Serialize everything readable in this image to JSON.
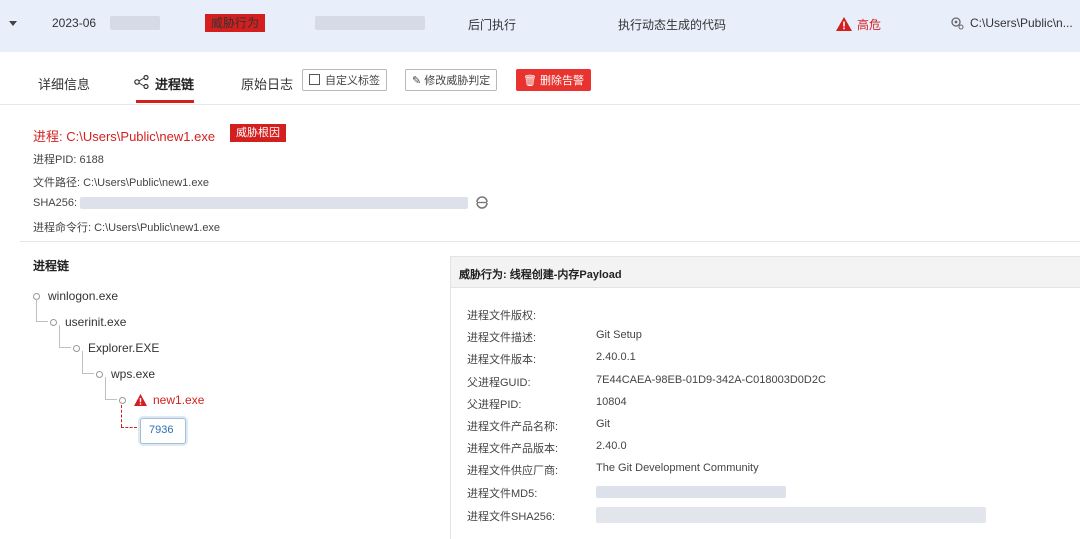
{
  "top_row": {
    "date": "2023-06",
    "category_tag": "威胁行为",
    "action": "后门执行",
    "description": "执行动态生成的代码",
    "severity": "高危",
    "path": "C:\\Users\\Public\\n..."
  },
  "tabs": [
    {
      "label": "详细信息"
    },
    {
      "label": "进程链"
    },
    {
      "label": "原始日志"
    }
  ],
  "toolbar": {
    "custom_tag": "自定义标签",
    "modify_verdict": "修改威胁判定",
    "delete_alert": "删除告警"
  },
  "process_info": {
    "process_label": "进程: C:\\Users\\Public\\new1.exe",
    "root_cause_tag": "威胁根因",
    "pid": "进程PID: 6188",
    "file_path": "文件路径: C:\\Users\\Public\\new1.exe",
    "sha256": "SHA256:",
    "cmdline": "进程命令行: C:\\Users\\Public\\new1.exe"
  },
  "tree": {
    "title": "进程链",
    "nodes": [
      "winlogon.exe",
      "userinit.exe",
      "Explorer.EXE",
      "wps.exe",
      "new1.exe"
    ],
    "thread_box": "7936"
  },
  "panel": {
    "title": "威胁行为: 线程创建-内存Payload",
    "rows": [
      {
        "k": "进程文件版权:",
        "v": ""
      },
      {
        "k": "进程文件描述:",
        "v": "Git Setup"
      },
      {
        "k": "进程文件版本:",
        "v": "2.40.0.1"
      },
      {
        "k": "父进程GUID:",
        "v": "7E44CAEA-98EB-01D9-342A-C018003D0D2C"
      },
      {
        "k": "父进程PID:",
        "v": "10804"
      },
      {
        "k": "进程文件产品名称:",
        "v": "Git"
      },
      {
        "k": "进程文件产品版本:",
        "v": "2.40.0"
      },
      {
        "k": "进程文件供应厂商:",
        "v": "The Git Development Community"
      },
      {
        "k": "进程文件MD5:",
        "v": ""
      },
      {
        "k": "进程文件SHA256:",
        "v": ""
      }
    ]
  },
  "colors": {
    "accent_red": "#d41f1f",
    "row_bg": "#e9eefb"
  }
}
